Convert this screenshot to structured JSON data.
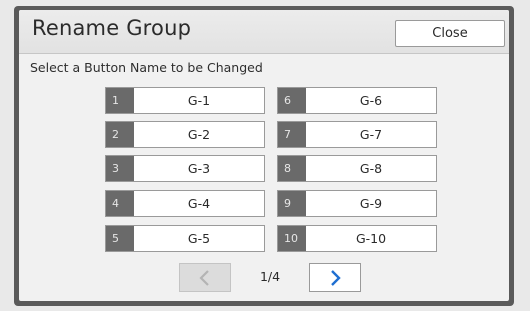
{
  "dialog": {
    "title": "Rename Group",
    "close_label": "Close",
    "instruction": "Select a Button Name to be Changed"
  },
  "groups": [
    {
      "num": "1",
      "label": "G-1"
    },
    {
      "num": "2",
      "label": "G-2"
    },
    {
      "num": "3",
      "label": "G-3"
    },
    {
      "num": "4",
      "label": "G-4"
    },
    {
      "num": "5",
      "label": "G-5"
    },
    {
      "num": "6",
      "label": "G-6"
    },
    {
      "num": "7",
      "label": "G-7"
    },
    {
      "num": "8",
      "label": "G-8"
    },
    {
      "num": "9",
      "label": "G-9"
    },
    {
      "num": "10",
      "label": "G-10"
    }
  ],
  "pagination": {
    "indicator": "1/4",
    "prev_icon": "chevron-left-icon",
    "next_icon": "chevron-right-icon",
    "prev_enabled": false,
    "next_enabled": true
  },
  "colors": {
    "frame": "#5a5a5a",
    "number_badge": "#6a6a6a",
    "accent_arrow": "#1f6fd1",
    "disabled_arrow": "#b4b4b4"
  }
}
